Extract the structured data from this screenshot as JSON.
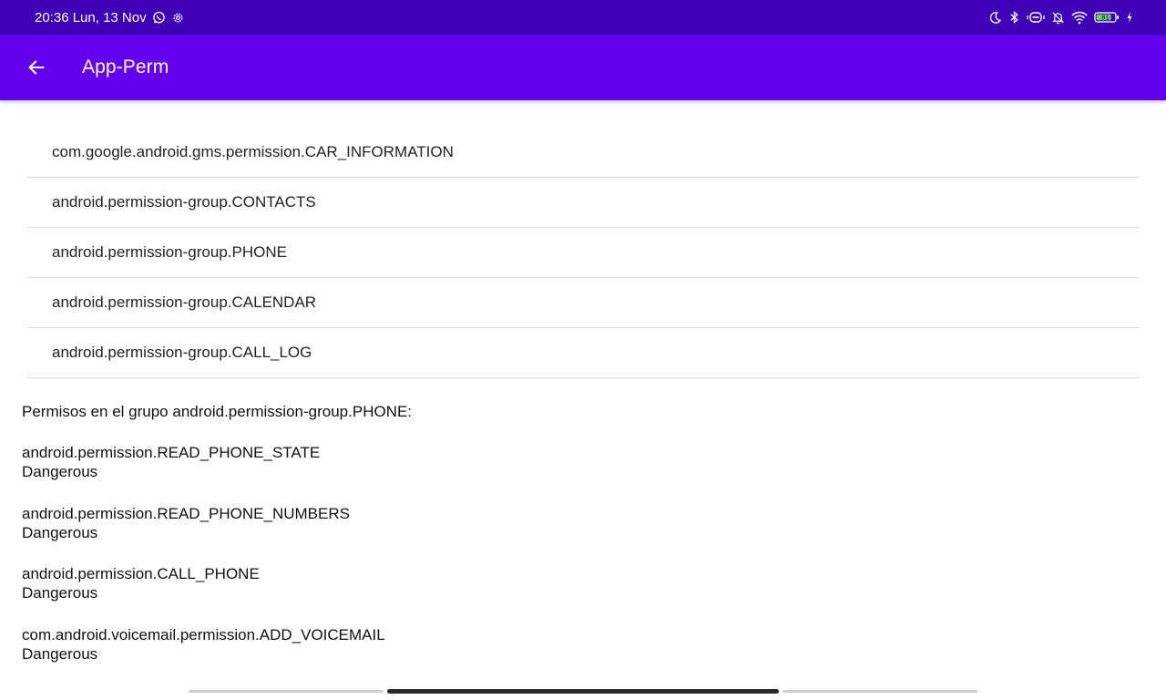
{
  "status_bar": {
    "time_date": "20:36 Lun, 13 Nov",
    "left_icons": [
      "whatsapp-icon",
      "settings-gear-icon"
    ],
    "right_icons": [
      "moon-icon",
      "bluetooth-icon",
      "vibrate-icon",
      "notifications-off-icon",
      "wifi-icon",
      "battery-icon",
      "charging-icon"
    ],
    "battery_level": "81"
  },
  "app_bar": {
    "back_icon": "arrow-back-icon",
    "title": "App-Perm",
    "color": "#6200ee"
  },
  "permission_groups": [
    {
      "label": "com.google.android.gms.permission.CAR_INFORMATION"
    },
    {
      "label": "android.permission-group.CONTACTS"
    },
    {
      "label": "android.permission-group.PHONE"
    },
    {
      "label": "android.permission-group.CALENDAR"
    },
    {
      "label": "android.permission-group.CALL_LOG"
    }
  ],
  "details": {
    "heading": "Permisos en el grupo android.permission-group.PHONE:",
    "permissions": [
      {
        "name": "android.permission.READ_PHONE_STATE",
        "level": "Dangerous"
      },
      {
        "name": "android.permission.READ_PHONE_NUMBERS",
        "level": "Dangerous"
      },
      {
        "name": "android.permission.CALL_PHONE",
        "level": "Dangerous"
      },
      {
        "name": "com.android.voicemail.permission.ADD_VOICEMAIL",
        "level": "Dangerous"
      }
    ]
  },
  "colors": {
    "status_bar": "#3f00b5",
    "app_bar": "#6200ee",
    "divider": "#dcdcdc"
  }
}
